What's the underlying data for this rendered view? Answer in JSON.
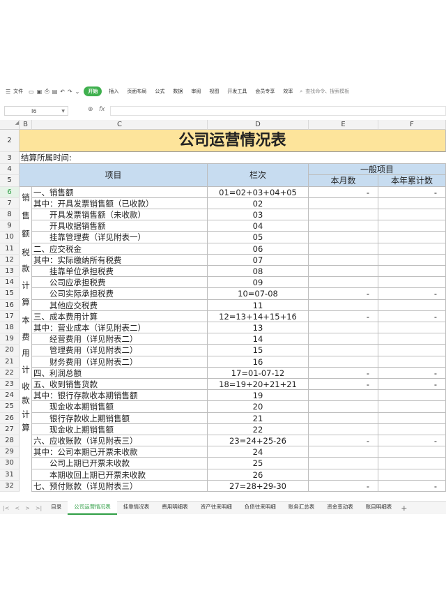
{
  "menubar": {
    "items": [
      "文件",
      "插入",
      "页面布局",
      "公式",
      "数据",
      "审阅",
      "视图",
      "开发工具",
      "会员专享",
      "效率"
    ],
    "file_label": "文件",
    "start_label": "开始",
    "search_placeholder": "查找命令、搜索模板"
  },
  "formula_bar": {
    "cell_ref": "I6",
    "fx": "fx",
    "value": ""
  },
  "columns": [
    "B",
    "C",
    "D",
    "E",
    "F"
  ],
  "title": "公司运营情况表",
  "settle_label": "结算所属时间:",
  "header": {
    "item": "项目",
    "col": "栏次",
    "group": "一般项目",
    "month": "本月数",
    "ytd": "本年累计数"
  },
  "side_labels": [
    "销售额",
    "税款计算",
    "本费用计",
    "收款计算"
  ],
  "rows": [
    {
      "n": "6",
      "item": "一、销售额",
      "col": "01=02+03+04+05",
      "e": "-",
      "f": "-"
    },
    {
      "n": "7",
      "item": "其中：开具发票销售额（已收款）",
      "col": "02",
      "e": "",
      "f": ""
    },
    {
      "n": "8",
      "item": "　　开具发票销售额（未收款）",
      "col": "03",
      "e": "",
      "f": ""
    },
    {
      "n": "9",
      "item": "　　开具收据销售额",
      "col": "04",
      "e": "",
      "f": ""
    },
    {
      "n": "10",
      "item": "　　挂靠管理费（详见附表一）",
      "col": "05",
      "e": "",
      "f": ""
    },
    {
      "n": "11",
      "item": "二、应交税金",
      "col": "06",
      "e": "",
      "f": ""
    },
    {
      "n": "12",
      "item": "其中：实际缴纳所有税费",
      "col": "07",
      "e": "",
      "f": ""
    },
    {
      "n": "13",
      "item": "　　挂靠单位承担税费",
      "col": "08",
      "e": "",
      "f": ""
    },
    {
      "n": "14",
      "item": "　　公司应承担税费",
      "col": "09",
      "e": "",
      "f": ""
    },
    {
      "n": "15",
      "item": "　　公司实际承担税费",
      "col": "10=07-08",
      "e": "-",
      "f": "-"
    },
    {
      "n": "16",
      "item": "　　其他应交税费",
      "col": "11",
      "e": "",
      "f": ""
    },
    {
      "n": "17",
      "item": "三、成本费用计算",
      "col": "12=13+14+15+16",
      "e": "-",
      "f": "-"
    },
    {
      "n": "18",
      "item": "其中：营业成本（详见附表二）",
      "col": "13",
      "e": "",
      "f": ""
    },
    {
      "n": "19",
      "item": "　　经营费用（详见附表二）",
      "col": "14",
      "e": "",
      "f": ""
    },
    {
      "n": "20",
      "item": "　　管理费用（详见附表二）",
      "col": "15",
      "e": "",
      "f": ""
    },
    {
      "n": "21",
      "item": "　　财务费用（详见附表二）",
      "col": "16",
      "e": "",
      "f": ""
    },
    {
      "n": "22",
      "item": "四、利润总额",
      "col": "17=01-07-12",
      "e": "-",
      "f": "-"
    },
    {
      "n": "23",
      "item": "五、收到销售货款",
      "col": "18=19+20+21+21",
      "e": "-",
      "f": "-"
    },
    {
      "n": "24",
      "item": "其中：银行存款收本期销售额",
      "col": "19",
      "e": "",
      "f": ""
    },
    {
      "n": "25",
      "item": "　　现金收本期销售额",
      "col": "20",
      "e": "",
      "f": ""
    },
    {
      "n": "26",
      "item": "　　银行存款收上期销售额",
      "col": "21",
      "e": "",
      "f": ""
    },
    {
      "n": "27",
      "item": "　　现金收上期销售额",
      "col": "22",
      "e": "",
      "f": ""
    },
    {
      "n": "28",
      "item": "六、应收账款（详见附表三）",
      "col": "23=24+25-26",
      "e": "-",
      "f": "-"
    },
    {
      "n": "29",
      "item": "其中：公司本期已开票未收款",
      "col": "24",
      "e": "",
      "f": ""
    },
    {
      "n": "30",
      "item": "　　公司上期已开票未收款",
      "col": "25",
      "e": "",
      "f": ""
    },
    {
      "n": "31",
      "item": "　　本期收回上期已开票未收款",
      "col": "26",
      "e": "",
      "f": ""
    },
    {
      "n": "32",
      "item": "七、预付账款（详见附表三）",
      "col": "27=28+29-30",
      "e": "-",
      "f": "-"
    }
  ],
  "sheet_tabs": [
    "目录",
    "公司运营情况表",
    "挂靠情况表",
    "费用明细表",
    "资产往来明细",
    "负债往来明细",
    "账务汇总表",
    "资金变动表",
    "账目明细表"
  ],
  "active_tab": "公司运营情况表",
  "colors": {
    "title_bg": "#fde49b",
    "header_bg": "#c7dcf0",
    "accent": "#3fb04e"
  }
}
